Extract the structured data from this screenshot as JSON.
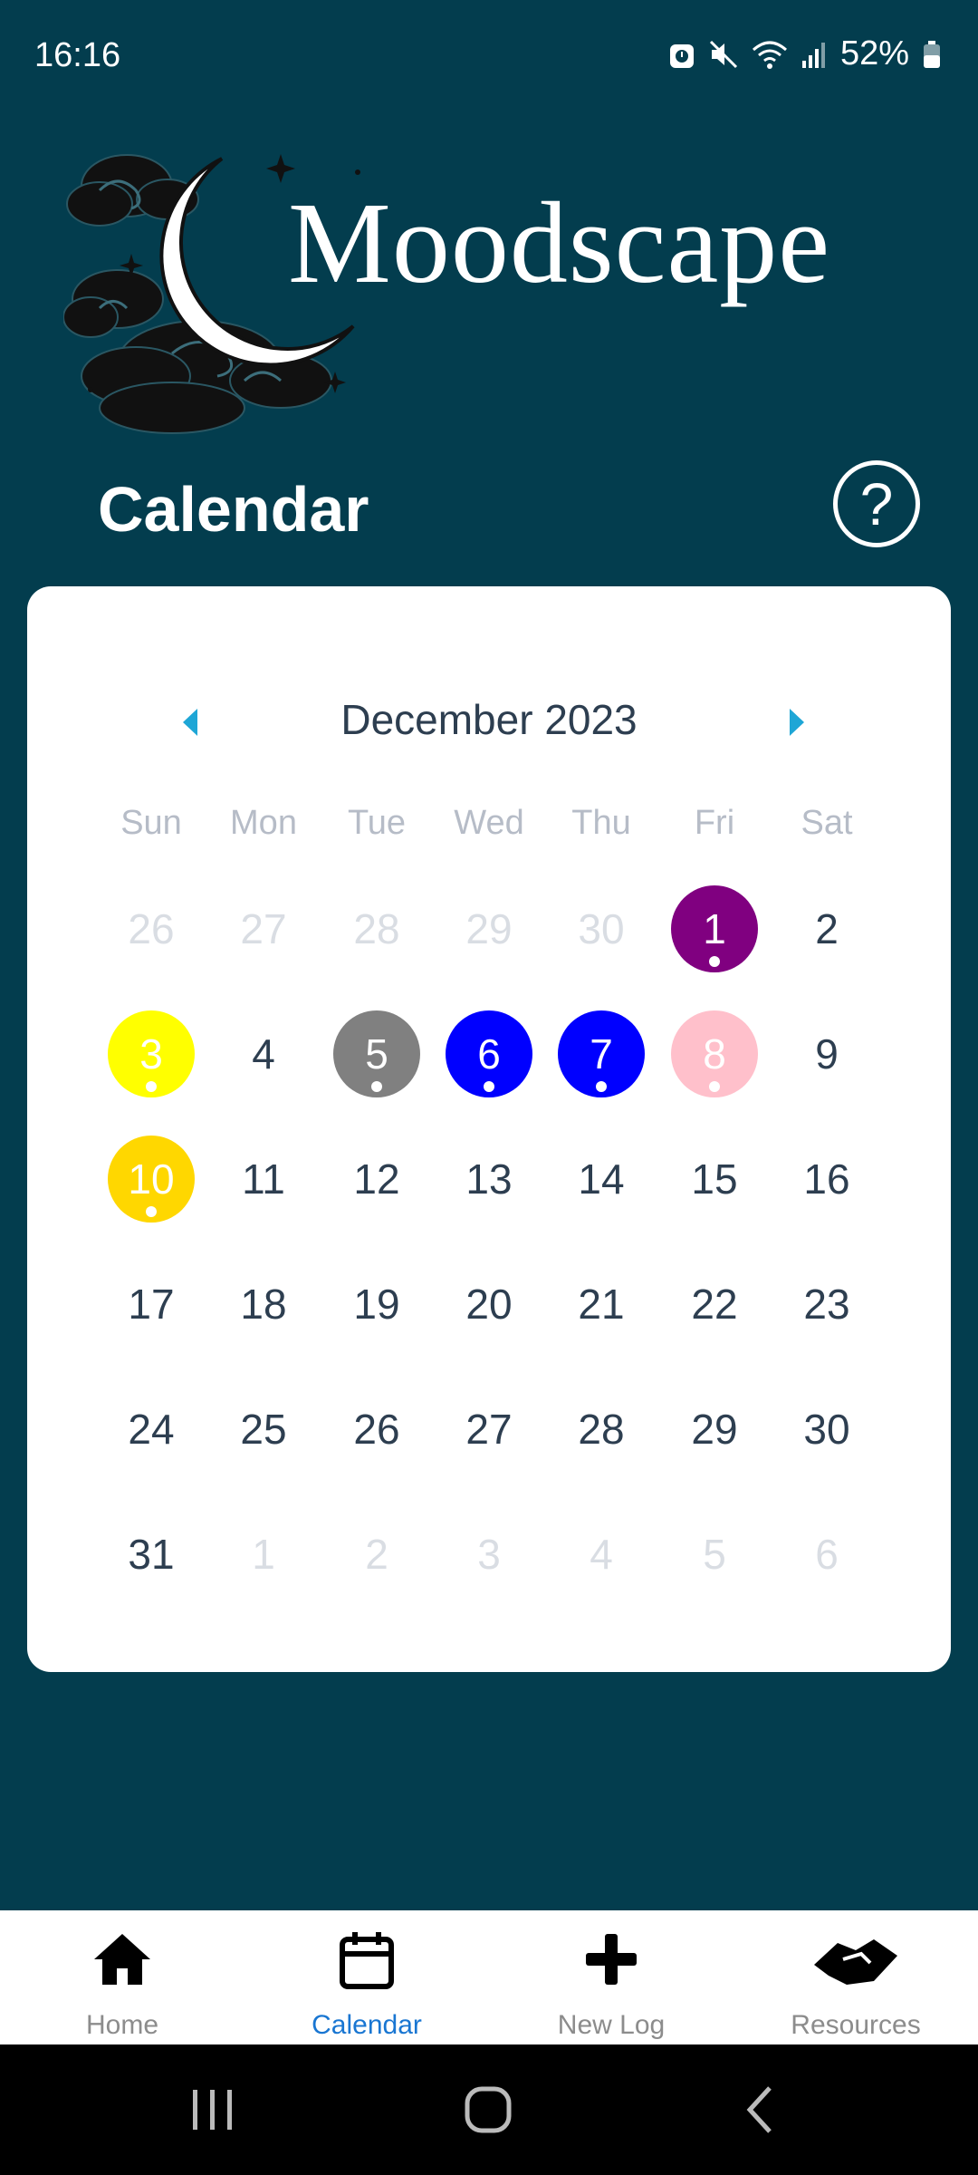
{
  "status_bar": {
    "time": "16:16",
    "battery": "52%",
    "icons": [
      "alarm-icon",
      "mute-icon",
      "wifi-icon",
      "signal-icon",
      "battery-icon"
    ]
  },
  "header": {
    "app_title": "Moodscape",
    "logo": "moon-clouds-logo"
  },
  "page": {
    "title": "Calendar",
    "help_label": "?"
  },
  "calendar": {
    "month_label": "December 2023",
    "weekdays": [
      "Sun",
      "Mon",
      "Tue",
      "Wed",
      "Thu",
      "Fri",
      "Sat"
    ],
    "weeks": [
      [
        {
          "d": "26",
          "o": true
        },
        {
          "d": "27",
          "o": true
        },
        {
          "d": "28",
          "o": true
        },
        {
          "d": "29",
          "o": true
        },
        {
          "d": "30",
          "o": true
        },
        {
          "d": "1",
          "c": "#800080"
        },
        {
          "d": "2"
        }
      ],
      [
        {
          "d": "3",
          "c": "#ffff00"
        },
        {
          "d": "4"
        },
        {
          "d": "5",
          "c": "#808080"
        },
        {
          "d": "6",
          "c": "#0000ff"
        },
        {
          "d": "7",
          "c": "#0000ff"
        },
        {
          "d": "8",
          "c": "#ffc0cb"
        },
        {
          "d": "9"
        }
      ],
      [
        {
          "d": "10",
          "c": "#ffd700"
        },
        {
          "d": "11"
        },
        {
          "d": "12"
        },
        {
          "d": "13"
        },
        {
          "d": "14"
        },
        {
          "d": "15"
        },
        {
          "d": "16"
        }
      ],
      [
        {
          "d": "17"
        },
        {
          "d": "18"
        },
        {
          "d": "19"
        },
        {
          "d": "20"
        },
        {
          "d": "21"
        },
        {
          "d": "22"
        },
        {
          "d": "23"
        }
      ],
      [
        {
          "d": "24"
        },
        {
          "d": "25"
        },
        {
          "d": "26"
        },
        {
          "d": "27"
        },
        {
          "d": "28"
        },
        {
          "d": "29"
        },
        {
          "d": "30"
        }
      ],
      [
        {
          "d": "31"
        },
        {
          "d": "1",
          "o": true
        },
        {
          "d": "2",
          "o": true
        },
        {
          "d": "3",
          "o": true
        },
        {
          "d": "4",
          "o": true
        },
        {
          "d": "5",
          "o": true
        },
        {
          "d": "6",
          "o": true
        }
      ]
    ],
    "accent_color": "#1ea6d6"
  },
  "bottom_nav": {
    "items": [
      {
        "label": "Home",
        "icon": "home-icon"
      },
      {
        "label": "Calendar",
        "icon": "calendar-icon",
        "active": true
      },
      {
        "label": "New Log",
        "icon": "plus-icon"
      },
      {
        "label": "Resources",
        "icon": "handshake-icon"
      }
    ],
    "active_color": "#1976d2"
  },
  "system_nav": {
    "buttons": [
      "recents-button",
      "home-button",
      "back-button"
    ]
  }
}
